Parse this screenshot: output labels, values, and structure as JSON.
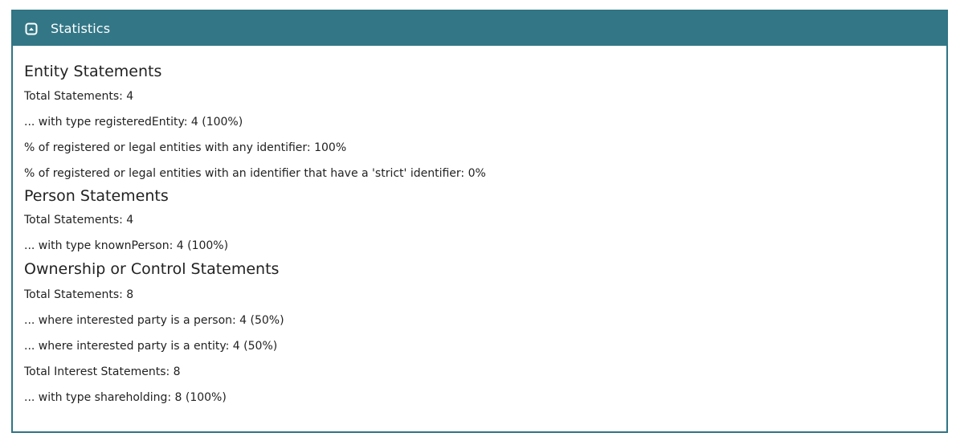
{
  "panel": {
    "title": "Statistics",
    "toggle_icon": "collapse-up-icon"
  },
  "sections": {
    "entity": {
      "heading": "Entity Statements",
      "lines": [
        "Total Statements: 4",
        "... with type registeredEntity: 4 (100%)",
        "% of registered or legal entities with any identifier: 100%",
        "% of registered or legal entities with an identifier that have a 'strict' identifier: 0%"
      ]
    },
    "person": {
      "heading": "Person Statements",
      "lines": [
        "Total Statements: 4",
        "... with type knownPerson: 4 (100%)"
      ]
    },
    "ownership": {
      "heading": "Ownership or Control Statements",
      "lines": [
        "Total Statements: 8",
        "... where interested party is a person: 4 (50%)",
        "... where interested party is a entity: 4 (50%)",
        "Total Interest Statements: 8",
        "... with type shareholding: 8 (100%)"
      ]
    }
  },
  "colors": {
    "header_bg": "#337786",
    "border": "#2f7585"
  }
}
